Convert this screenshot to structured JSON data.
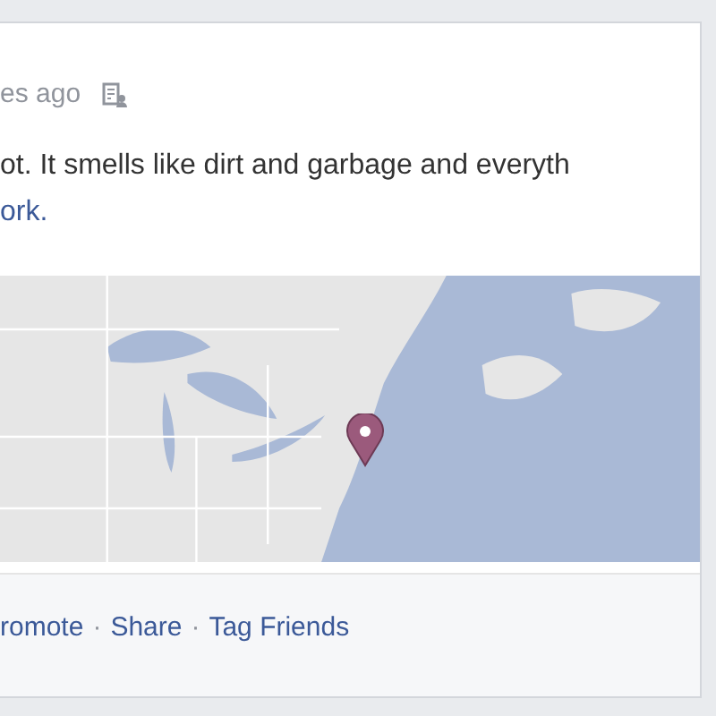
{
  "post": {
    "timestamp": "es ago",
    "text": "ot. It smells like dirt and garbage and everyth",
    "place_link": "ork.",
    "actions": [
      {
        "kind": "link",
        "label": "romote"
      },
      {
        "kind": "separator",
        "label": "·"
      },
      {
        "kind": "link",
        "label": "Share"
      },
      {
        "kind": "separator",
        "label": "·"
      },
      {
        "kind": "link",
        "label": "Tag Friends"
      }
    ]
  }
}
